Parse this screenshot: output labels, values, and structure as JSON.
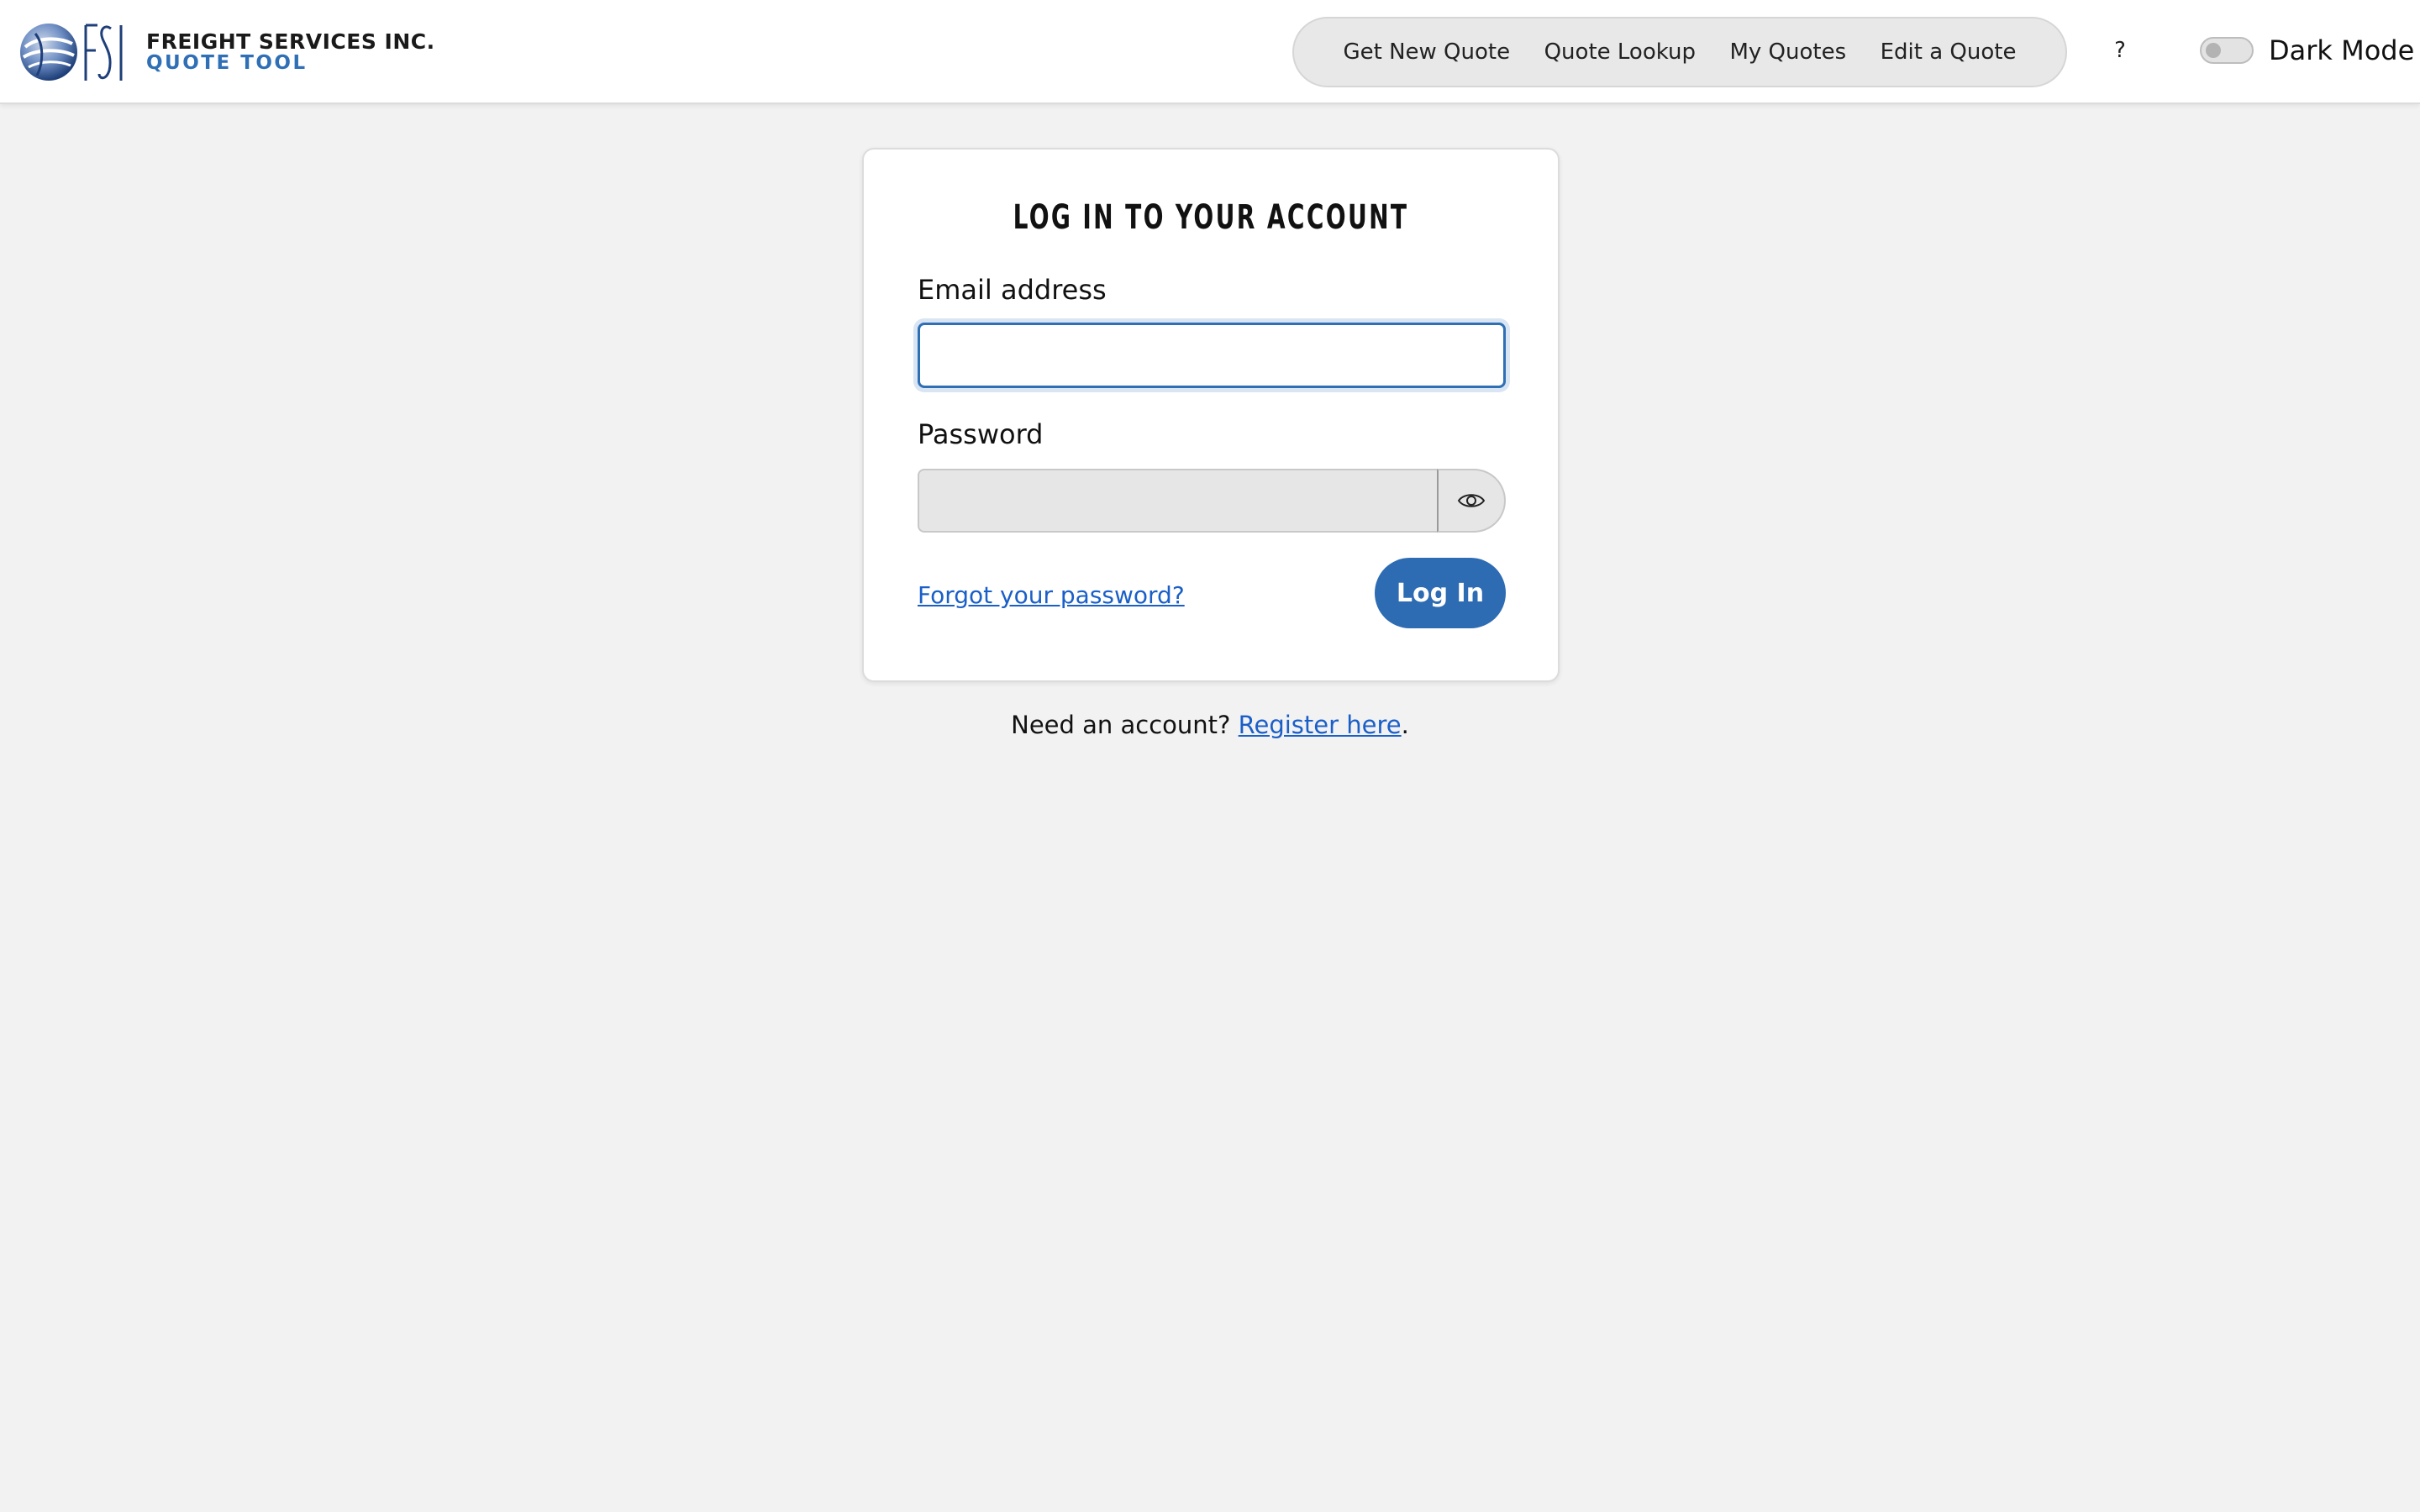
{
  "header": {
    "logo": {
      "company": "FREIGHT SERVICES INC.",
      "product": "QUOTE TOOL"
    },
    "nav": [
      {
        "label": "Get New Quote"
      },
      {
        "label": "Quote Lookup"
      },
      {
        "label": "My Quotes"
      },
      {
        "label": "Edit a Quote"
      }
    ],
    "help_label": "?",
    "dark_mode": {
      "label": "Dark Mode",
      "enabled": false
    }
  },
  "login": {
    "title": "LOG IN TO YOUR ACCOUNT",
    "email": {
      "label": "Email address",
      "value": "",
      "placeholder": ""
    },
    "password": {
      "label": "Password",
      "value": "",
      "placeholder": ""
    },
    "reveal_icon": "eye-icon",
    "forgot_link": "Forgot your password?",
    "submit_label": "Log In"
  },
  "register": {
    "prefix": "Need an account? ",
    "link": "Register here",
    "suffix": "."
  },
  "colors": {
    "accent": "#2d6bb3",
    "link": "#1a5fc8",
    "page_background": "#f2f2f2",
    "logo_blue": "#1f3f7a"
  }
}
